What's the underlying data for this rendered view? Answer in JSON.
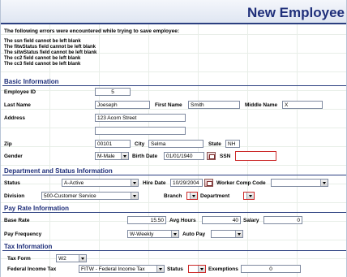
{
  "page": {
    "title": "New Employee"
  },
  "errors": {
    "heading": "The following errors were encountered while trying to save employee:",
    "items": [
      "The ssn field cannot be left blank",
      "The fitwStatus field cannot be left blank",
      "The sitwStatus field cannot be left blank",
      "The cc2 field cannot be left blank",
      "The cc3 field cannot be left blank"
    ]
  },
  "basic": {
    "section_title": "Basic Information",
    "employee_id_label": "Employee ID",
    "employee_id": "5",
    "last_name_label": "Last Name",
    "last_name": "Joeseph",
    "first_name_label": "First Name",
    "first_name": "Smith",
    "middle_name_label": "Middle Name",
    "middle_name": "X",
    "address_label": "Address",
    "address_line1": "123 Acorn Street",
    "address_line2": "",
    "zip_label": "Zip",
    "zip": "00101",
    "city_label": "City",
    "city": "Selma",
    "state_label": "State",
    "state": "NH",
    "gender_label": "Gender",
    "gender": "M-Male",
    "birth_date_label": "Birth Date",
    "birth_date": "01/01/1940",
    "ssn_label": "SSN",
    "ssn": ""
  },
  "department": {
    "section_title": "Department and Status Information",
    "status_label": "Status",
    "status": "A-Active",
    "hire_date_label": "Hire Date",
    "hire_date": "10/29/2004",
    "worker_comp_label": "Worker Comp Code",
    "worker_comp": "",
    "division_label": "Division",
    "division": "500-Customer Service",
    "branch_label": "Branch",
    "branch": "",
    "department_label": "Department",
    "department": ""
  },
  "payrate": {
    "section_title": "Pay Rate Information",
    "base_rate_label": "Base Rate",
    "base_rate": "15.50",
    "avg_hours_label": "Avg Hours",
    "avg_hours": "40",
    "salary_label": "Salary",
    "salary": "0",
    "pay_frequency_label": "Pay Frequency",
    "pay_frequency": "W-Weekly",
    "auto_pay_label": "Auto Pay",
    "auto_pay": ""
  },
  "tax": {
    "section_title": "Tax Information",
    "tax_form_label": "Tax Form",
    "tax_form": "W2",
    "federal_income_tax_label": "Federal Income Tax",
    "federal_income_tax": "FITW - Federal Income Tax",
    "status_label": "Status",
    "status": "",
    "exemptions_label": "Exemptions",
    "exemptions": "0"
  },
  "colors": {
    "accent": "#1f2f7a",
    "error_border": "#cc2a2a"
  }
}
